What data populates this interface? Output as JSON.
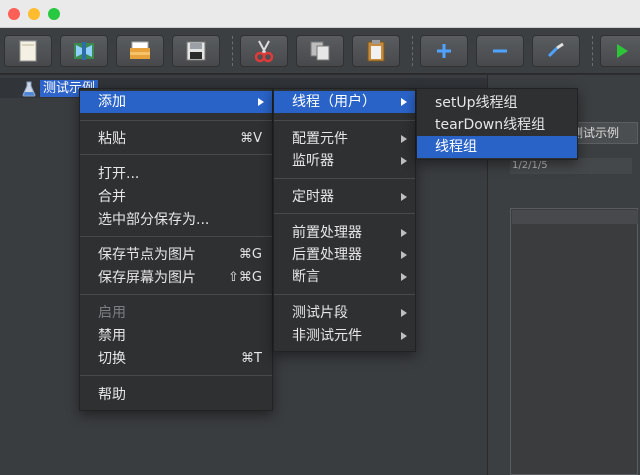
{
  "toolbar": {
    "buttons": [
      {
        "icon": "new-file-icon"
      },
      {
        "icon": "templates-icon"
      },
      {
        "icon": "open-folder-icon"
      },
      {
        "icon": "save-icon"
      },
      {
        "icon": "cut-icon"
      },
      {
        "icon": "copy-icon"
      },
      {
        "icon": "paste-icon"
      },
      {
        "icon": "expand-icon"
      },
      {
        "icon": "collapse-icon"
      },
      {
        "icon": "toggle-icon"
      },
      {
        "icon": "start-icon"
      }
    ]
  },
  "tree": {
    "root_label": "测试示例"
  },
  "right_panel": {
    "title_fragment": "例",
    "button_fragment": "测试示例",
    "field_fragment": "1/2/1/5"
  },
  "context_menu": {
    "items": [
      {
        "label": "添加"
      },
      {
        "label": "粘贴",
        "shortcut": "⌘V"
      },
      {
        "label": "打开..."
      },
      {
        "label": "合并"
      },
      {
        "label": "选中部分保存为..."
      },
      {
        "label": "保存节点为图片",
        "shortcut": "⌘G"
      },
      {
        "label": "保存屏幕为图片",
        "shortcut": "⇧⌘G"
      },
      {
        "label": "启用"
      },
      {
        "label": "禁用"
      },
      {
        "label": "切换",
        "shortcut": "⌘T"
      },
      {
        "label": "帮助"
      }
    ]
  },
  "add_submenu": {
    "items": [
      {
        "label": "线程（用户）"
      },
      {
        "label": "配置元件"
      },
      {
        "label": "监听器"
      },
      {
        "label": "定时器"
      },
      {
        "label": "前置处理器"
      },
      {
        "label": "后置处理器"
      },
      {
        "label": "断言"
      },
      {
        "label": "测试片段"
      },
      {
        "label": "非测试元件"
      }
    ]
  },
  "threads_submenu": {
    "items": [
      {
        "label": "setUp线程组"
      },
      {
        "label": "tearDown线程组"
      },
      {
        "label": "线程组"
      }
    ]
  },
  "colors": {
    "selection": "#2a63c8",
    "menu_bg": "#2e3032",
    "toolbar_bg": "#3c3f41"
  }
}
